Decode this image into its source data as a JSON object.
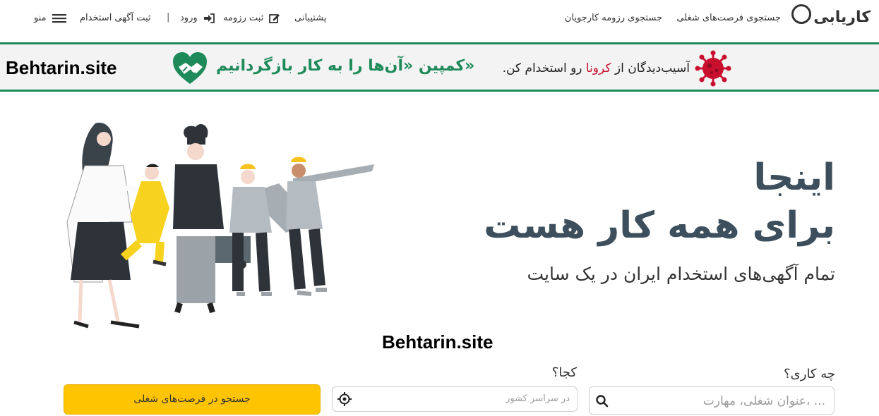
{
  "nav": {
    "logo_text": "کاریابی",
    "job_search": "جستجوی فرصت‌های شغلی",
    "resume_search": "جستجوی رزومه کارجویان",
    "support": "پشتیبانی",
    "submit_resume": "ثبت رزومه",
    "login": "ورود",
    "separator": "|",
    "post_job": "ثبت آگهی استخدام",
    "menu": "منو"
  },
  "banner": {
    "watermark": "Behtarin.site",
    "campaign": "کمپین «آن‌ها را به کار بازگردانیم»",
    "corona_pre": "آسیب‌دیدگان از ",
    "corona_word": "کرونا",
    "corona_post": " رو استخدام کن."
  },
  "hero": {
    "line1": "اینجا",
    "line2": "برای همه کار هست",
    "subtitle": "تمام آگهی‌های استخدام ایران در یک سایت",
    "watermark": "Behtarin.site"
  },
  "search": {
    "what_label": "چه کاری؟",
    "what_placeholder": "عنوان شغلی، مهارت، ...",
    "where_label": "کجا؟",
    "where_placeholder": "در سراسر کشور",
    "button": "جستجو در فرصت‌های شغلی"
  },
  "colors": {
    "brand_green": "#1e8a5a",
    "accent_yellow": "#ffc400",
    "hero_text": "#3d4f5c",
    "corona_red": "#c8102e"
  }
}
